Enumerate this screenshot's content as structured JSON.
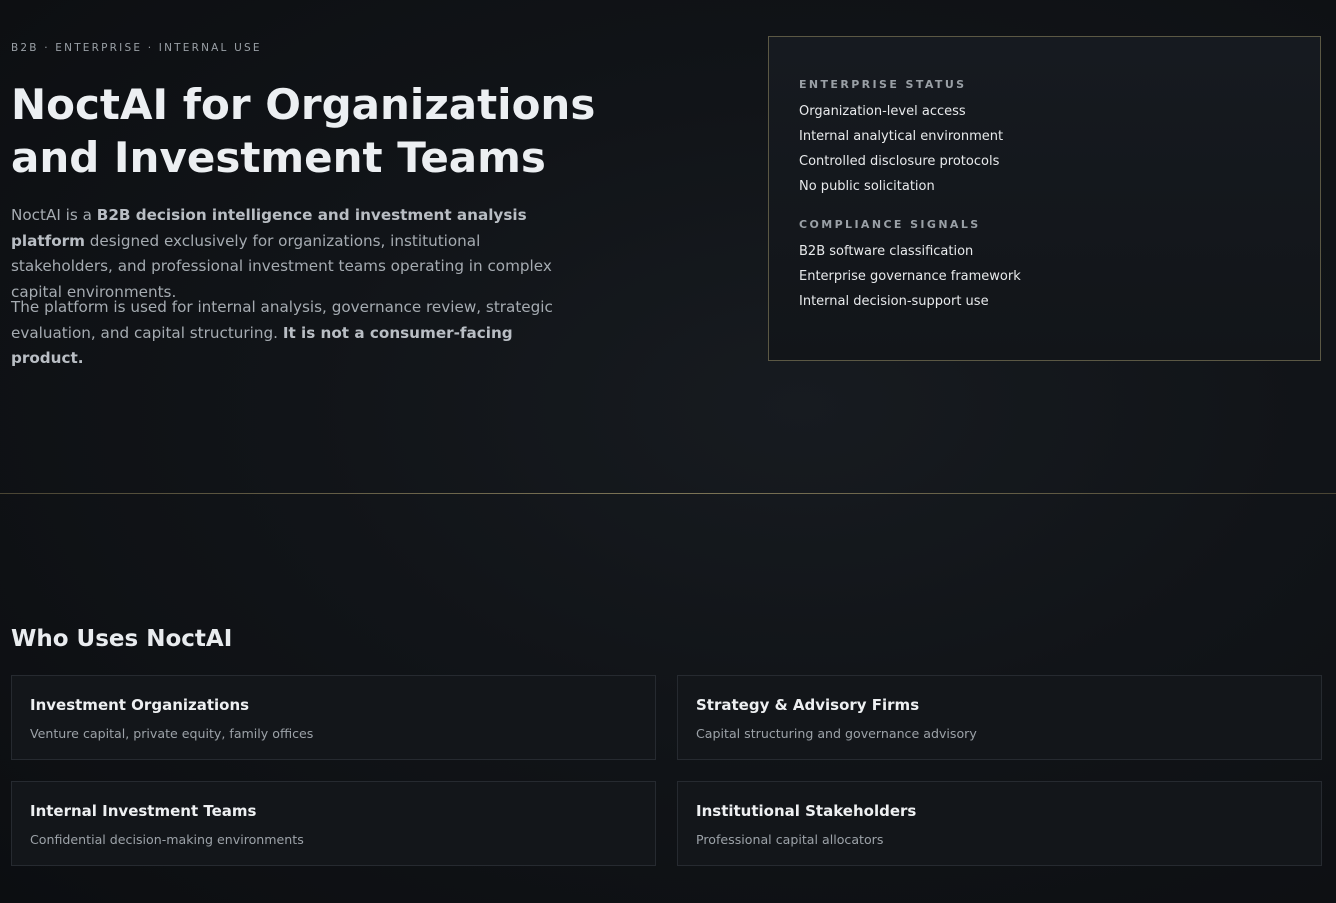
{
  "hero": {
    "eyebrow": "B2B · ENTERPRISE · INTERNAL USE",
    "title": "NoctAI for Organizations and Investment Teams",
    "p1_lead": "NoctAI is a ",
    "p1_bold": "B2B decision intelligence and investment analysis platform",
    "p1_rest": " designed exclusively for organizations, institutional stakeholders, and professional investment teams operating in complex capital environments.",
    "p2_lead": "The platform is used for internal analysis, governance review, strategic evaluation, and capital structuring. ",
    "p2_bold": "It is not a consumer-facing product."
  },
  "status_panel": {
    "enterprise_heading": "ENTERPRISE STATUS",
    "enterprise_items": [
      "Organization-level access",
      "Internal analytical environment",
      "Controlled disclosure protocols",
      "No public solicitation"
    ],
    "compliance_heading": "COMPLIANCE SIGNALS",
    "compliance_items": [
      "B2B software classification",
      "Enterprise governance framework",
      "Internal decision-support use"
    ]
  },
  "users": {
    "title": "Who Uses NoctAI",
    "cards": [
      {
        "title": "Investment Organizations",
        "desc": "Venture capital, private equity, family offices"
      },
      {
        "title": "Strategy & Advisory Firms",
        "desc": "Capital structuring and governance advisory"
      },
      {
        "title": "Internal Investment Teams",
        "desc": "Confidential decision-making environments"
      },
      {
        "title": "Institutional Stakeholders",
        "desc": "Professional capital allocators"
      }
    ]
  },
  "colors": {
    "background": "#111418",
    "accent_gold": "#7d7557",
    "text_primary": "#eceff2",
    "text_muted": "#a5abb1"
  }
}
